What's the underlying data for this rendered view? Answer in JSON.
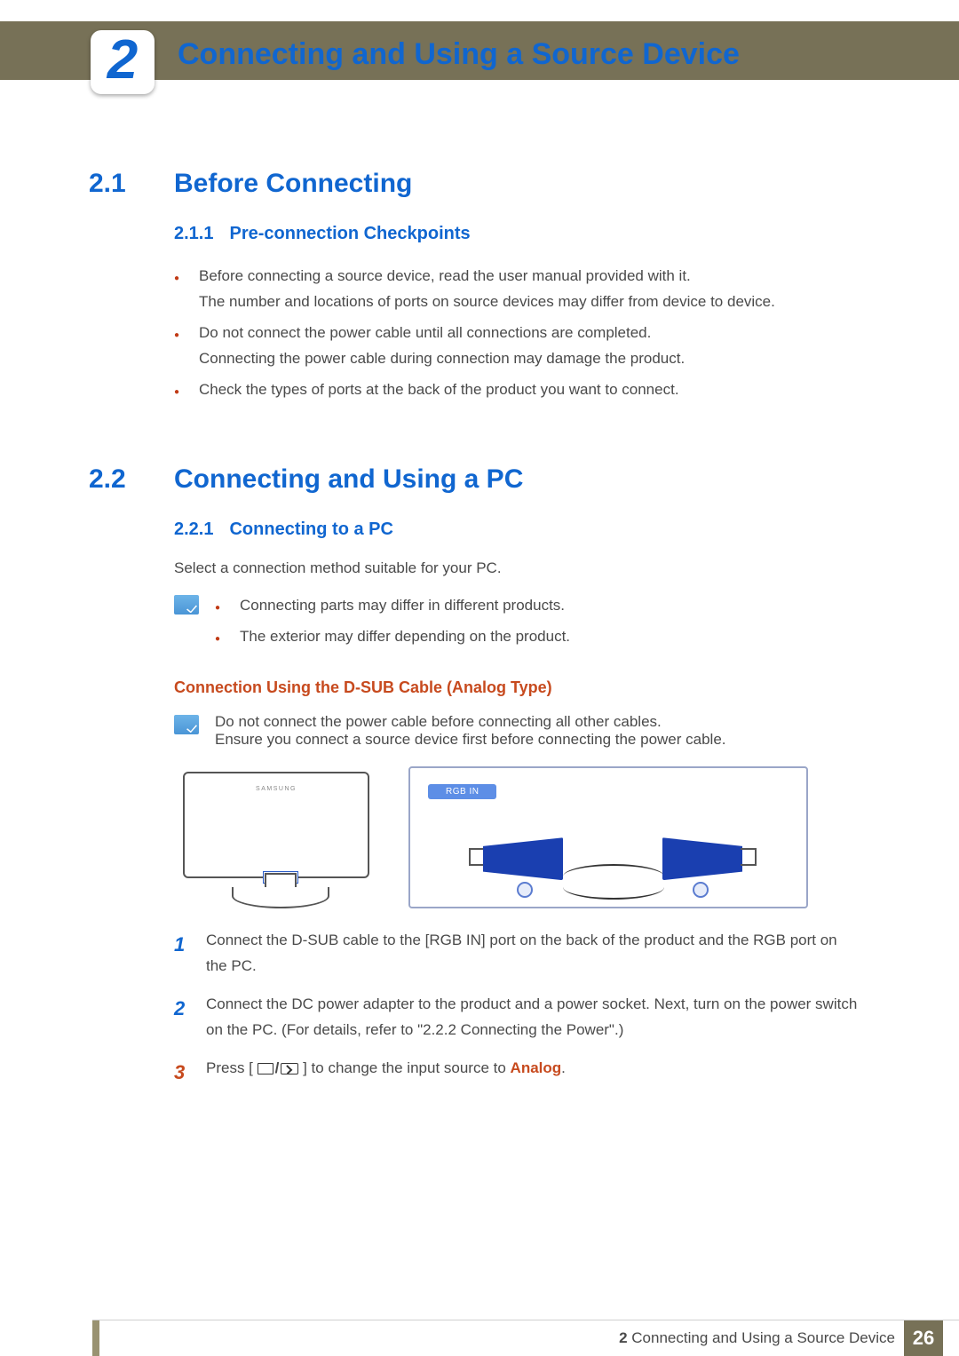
{
  "chapter": {
    "number": "2",
    "title": "Connecting and Using a Source Device"
  },
  "s1": {
    "num": "2.1",
    "title": "Before Connecting",
    "sub": {
      "num": "2.1.1",
      "title": "Pre-connection Checkpoints"
    },
    "b1a": "Before connecting a source device, read the user manual provided with it.",
    "b1b": "The number and locations of ports on source devices may differ from device to device.",
    "b2a": "Do not connect the power cable until all connections are completed.",
    "b2b": "Connecting the power cable during connection may damage the product.",
    "b3": "Check the types of ports at the back of the product you want to connect."
  },
  "s2": {
    "num": "2.2",
    "title": "Connecting and Using a PC",
    "sub": {
      "num": "2.2.1",
      "title": "Connecting to a PC"
    },
    "intro": "Select a connection method suitable for your PC.",
    "note1": "Connecting parts may differ in different products.",
    "note2": "The exterior may differ depending on the product.",
    "h4": "Connection Using the D-SUB Cable (Analog Type)",
    "warn1": "Do not connect the power cable before connecting all other cables.",
    "warn2": "Ensure you connect a source device first before connecting the power cable.",
    "portlabel": "RGB IN",
    "brand": "SAMSUNG",
    "step1": "Connect the D-SUB cable to the [RGB IN] port on the back of the product and the RGB port on the PC.",
    "step2": "Connect the DC power adapter to the product and a power socket. Next, turn on the power switch on the PC. (For details, refer to \"2.2.2    Connecting the Power\".)",
    "step3a": "Press [",
    "step3b": "] to change the input source to ",
    "analog": "Analog",
    "period": "."
  },
  "footer": {
    "chapnum": "2",
    "chaptitle": "Connecting and Using a Source Device",
    "page": "26"
  }
}
